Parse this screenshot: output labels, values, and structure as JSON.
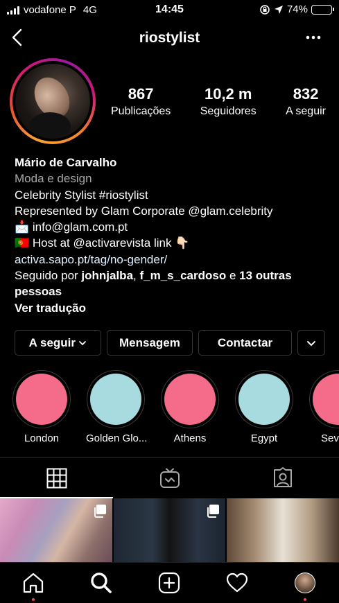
{
  "status_bar": {
    "carrier": "vodafone P",
    "network": "4G",
    "time": "14:45",
    "battery": "74%",
    "battery_level": 0.74
  },
  "header": {
    "username": "riostylist"
  },
  "profile": {
    "stats": [
      {
        "value": "867",
        "label": "Publicações"
      },
      {
        "value": "10,2 m",
        "label": "Seguidores"
      },
      {
        "value": "832",
        "label": "A seguir"
      }
    ],
    "name": "Mário de Carvalho",
    "category": "Moda e design",
    "bio_line1": "Celebrity Stylist #riostylist",
    "bio_line2": "Represented by Glam Corporate @glam.celebrity",
    "bio_line3_emoji": "📩",
    "bio_line3_text": "info@glam.com.pt",
    "bio_line4_emoji": "🇵🇹",
    "bio_line4_text": "Host at @activarevista link",
    "bio_line4_emoji_end": "👇🏻",
    "website": "activa.sapo.pt/tag/no-gender/",
    "followed_by_prefix": "Seguido por ",
    "followed_by_user1": "johnjalba",
    "followed_by_sep": ", ",
    "followed_by_user2": "f_m_s_cardoso",
    "followed_by_and": " e ",
    "followed_by_more": "13 outras pessoas",
    "see_translation": "Ver tradução"
  },
  "actions": {
    "following_label": "A seguir",
    "message_label": "Mensagem",
    "contact_label": "Contactar"
  },
  "highlights": [
    {
      "label": "London",
      "color": "#f56b8a"
    },
    {
      "label": "Golden Glo...",
      "color": "#a7dbe0"
    },
    {
      "label": "Athens",
      "color": "#f56b8a"
    },
    {
      "label": "Egypt",
      "color": "#a7dbe0"
    },
    {
      "label": "Sev",
      "color": "#f56b8a"
    }
  ],
  "tabs": [
    {
      "icon": "grid-icon",
      "active": true
    },
    {
      "icon": "igtv-icon",
      "active": false
    },
    {
      "icon": "tagged-icon",
      "active": false
    }
  ],
  "bottom_nav": [
    {
      "icon": "home-icon"
    },
    {
      "icon": "search-icon"
    },
    {
      "icon": "new-post-icon"
    },
    {
      "icon": "heart-icon"
    },
    {
      "icon": "profile-avatar"
    }
  ]
}
